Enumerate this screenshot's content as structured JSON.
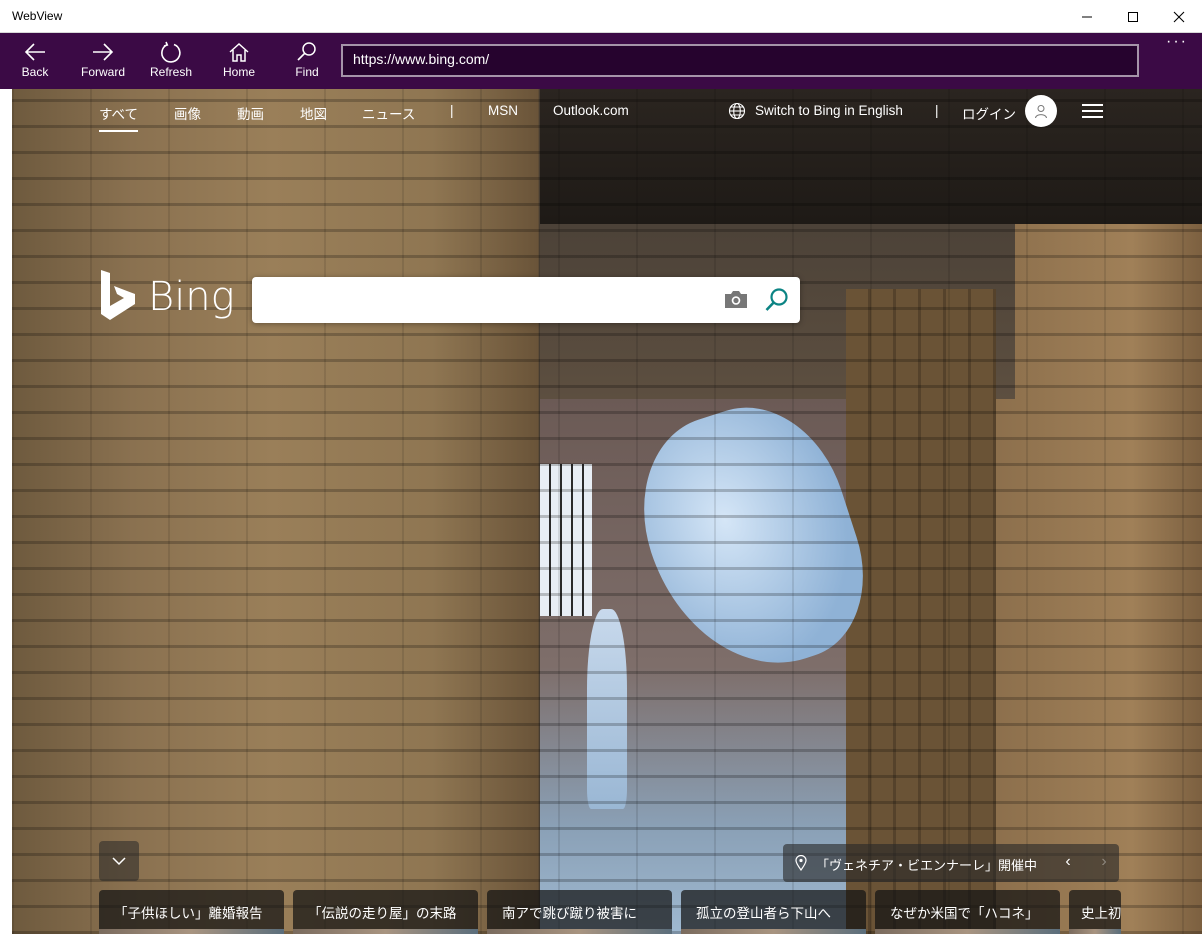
{
  "window": {
    "title": "WebView"
  },
  "toolbar": {
    "buttons": [
      {
        "label": "Back",
        "icon": "back-arrow-icon"
      },
      {
        "label": "Forward",
        "icon": "forward-arrow-icon"
      },
      {
        "label": "Refresh",
        "icon": "refresh-icon"
      },
      {
        "label": "Home",
        "icon": "home-icon"
      },
      {
        "label": "Find",
        "icon": "search-icon"
      }
    ],
    "url": "https://www.bing.com/",
    "more": "···"
  },
  "bing": {
    "nav": {
      "items": [
        "すべて",
        "画像",
        "動画",
        "地図",
        "ニュース",
        "|",
        "MSN",
        "Outlook.com"
      ],
      "switch_language": "Switch to Bing in English",
      "separator": "|",
      "login": "ログイン"
    },
    "logo_text": "Bing",
    "search": {
      "value": "",
      "placeholder": ""
    },
    "caption": {
      "text": "「ヴェネチア・ビエンナーレ」開催中",
      "prev": "‹",
      "next": "›"
    },
    "news": [
      "「子供ほしい」離婚報告",
      "「伝説の走り屋」の末路",
      "南アで跳び蹴り被害に",
      "孤立の登山者ら下山へ",
      "なぜか米国で「ハコネ」",
      "史上初"
    ]
  },
  "colors": {
    "toolbar_bg": "#3b0a45",
    "url_bg": "#26032e",
    "bing_search_icon": "#0c8484"
  }
}
